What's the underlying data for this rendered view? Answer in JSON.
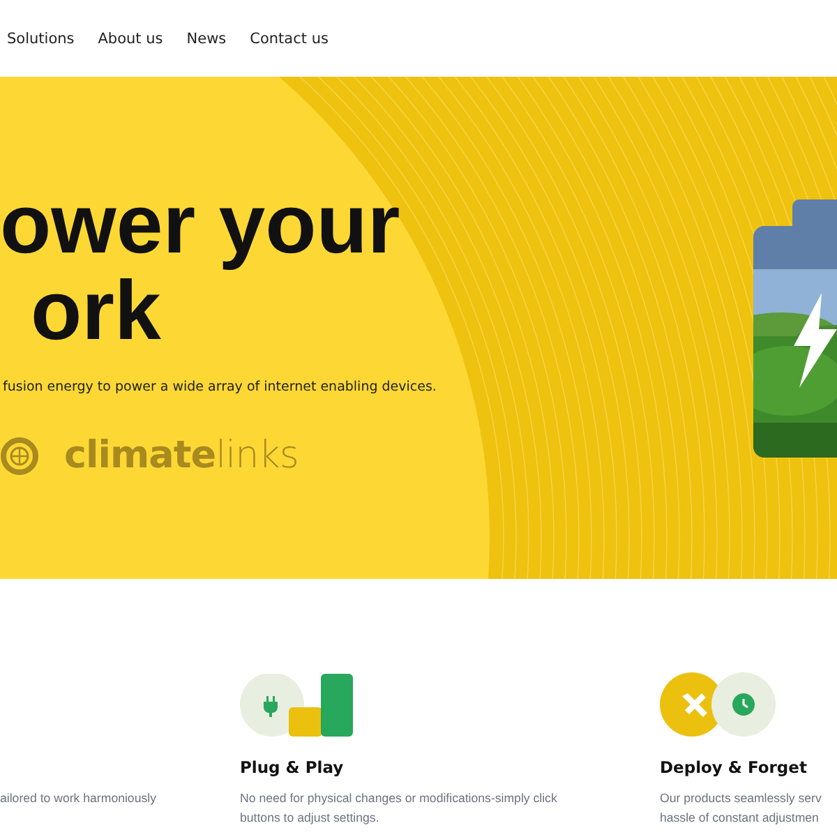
{
  "nav": [
    {
      "label": "Solutions"
    },
    {
      "label": "About us"
    },
    {
      "label": "News"
    },
    {
      "label": "Contact us"
    }
  ],
  "hero": {
    "headline": [
      "ower your",
      "ork"
    ],
    "subtitle": "fusion energy to power a wide array of internet enabling devices.",
    "partner_logo": "**climate**links"
  },
  "features": [
    {
      "kind": "text",
      "lines": [
        "ailored to work harmoniously"
      ]
    },
    {
      "kind": "plug",
      "title": "Plug & Play",
      "lines": [
        "No need for physical changes or modifications-simply click",
        "buttons to adjust settings."
      ]
    },
    {
      "kind": "deploy",
      "title": "Deploy & Forget",
      "lines": [
        "Our products seamlessly serv",
        "hassle of constant adjustmen"
      ]
    }
  ]
}
